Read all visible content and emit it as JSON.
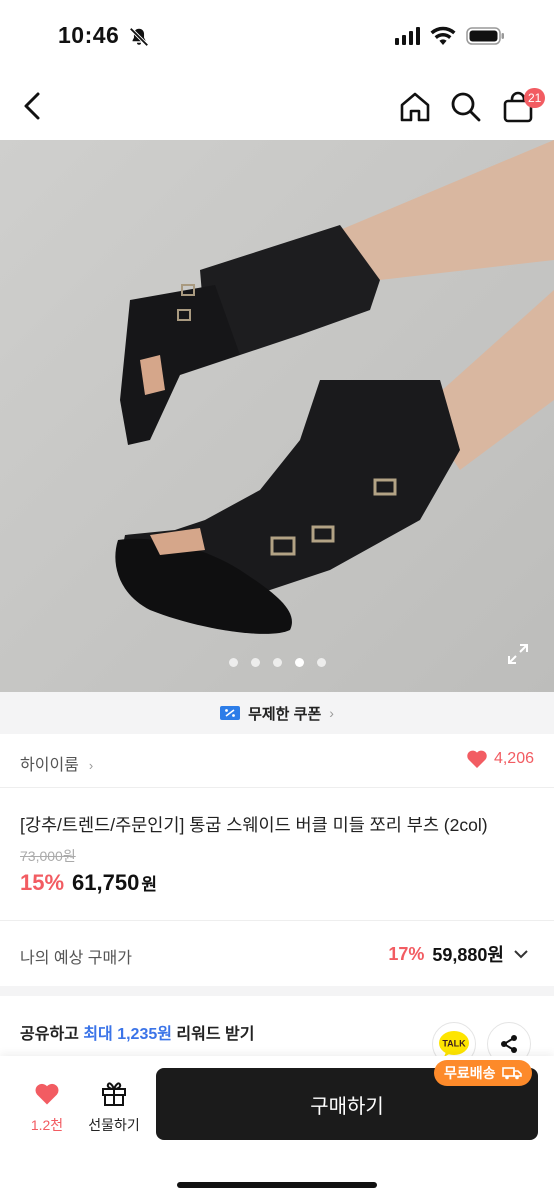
{
  "status_bar": {
    "time": "10:46",
    "icons": [
      "bell-off-icon",
      "signal-icon",
      "wifi-icon",
      "battery-icon"
    ]
  },
  "nav": {
    "icons": [
      "back-icon",
      "home-icon",
      "search-icon",
      "shopping-bag-icon"
    ],
    "cart_count": "21"
  },
  "gallery": {
    "image_description_icon": "product-photo",
    "page_count": 5,
    "active_page": 4,
    "expand_icon": "expand-icon"
  },
  "coupon": {
    "label": "무제한 쿠폰",
    "chevron": "›"
  },
  "brand": {
    "name": "하이이룸",
    "chevron": "›",
    "like_count": "4,206"
  },
  "product": {
    "title": "[강추/트렌드/주문인기]  통굽 스웨이드 버클 미들 쪼리 부츠 (2col)",
    "original_price": "73,000원",
    "discount": "15%",
    "price": "61,750",
    "currency": "원"
  },
  "expected_price": {
    "label": "나의 예상 구매가",
    "discount": "17%",
    "price": "59,880원"
  },
  "share": {
    "prefix": "공유하고 ",
    "highlight": "최대 1,235원",
    "suffix": " 리워드 받기",
    "kakao_label": "TALK"
  },
  "bottom_bar": {
    "wish_count": "1.2천",
    "gift_label": "선물하기",
    "buy_label": "구매하기",
    "free_shipping_label": "무료배송"
  },
  "colors": {
    "accent_red": "#f25c62",
    "link_blue": "#3b74e8",
    "buy_button": "#1b1b1b",
    "free_shipping": "#fd8a2a",
    "kakao_yellow": "#fee500"
  }
}
